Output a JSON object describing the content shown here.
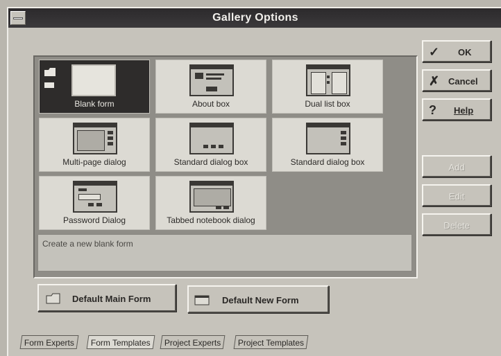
{
  "window": {
    "title": "Gallery Options"
  },
  "gallery": {
    "items": [
      {
        "label": "Blank form",
        "selected": true,
        "icon": "blank-form-icon"
      },
      {
        "label": "About box",
        "selected": false,
        "icon": "about-box-icon"
      },
      {
        "label": "Dual list box",
        "selected": false,
        "icon": "dual-list-box-icon"
      },
      {
        "label": "Multi-page dialog",
        "selected": false,
        "icon": "multi-page-dialog-icon"
      },
      {
        "label": "Standard dialog box",
        "selected": false,
        "icon": "standard-dialog-box-icon"
      },
      {
        "label": "Standard dialog box",
        "selected": false,
        "icon": "standard-dialog-box-icon"
      },
      {
        "label": "Password Dialog",
        "selected": false,
        "icon": "password-dialog-icon"
      },
      {
        "label": "Tabbed notebook dialog",
        "selected": false,
        "icon": "tabbed-notebook-dialog-icon"
      }
    ],
    "description": "Create a new blank form"
  },
  "buttons": {
    "ok": "OK",
    "cancel": "Cancel",
    "help": "Help",
    "add": "Add",
    "edit": "Edit",
    "delete": "Delete",
    "default_main_form": "Default Main Form",
    "default_new_form": "Default New Form"
  },
  "tabs": [
    {
      "label": "Form Experts",
      "active": false
    },
    {
      "label": "Form Templates",
      "active": true
    },
    {
      "label": "Project Experts",
      "active": false
    },
    {
      "label": "Project Templates",
      "active": false
    }
  ],
  "colors": {
    "title_bar": "#2c2a2c",
    "selected_item": "#2e2c2b",
    "face": "#c6c3bb"
  }
}
